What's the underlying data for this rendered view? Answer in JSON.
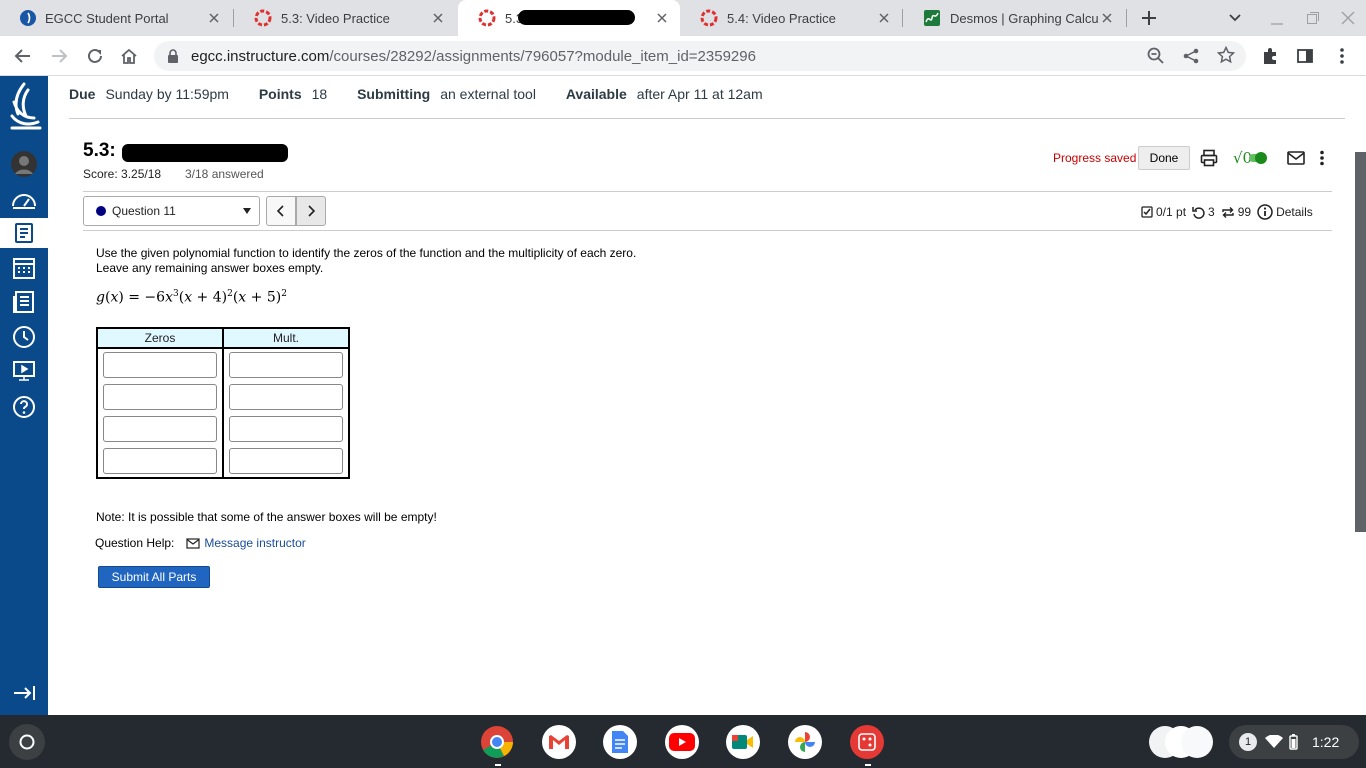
{
  "browser": {
    "tabs": [
      {
        "title": "EGCC Student Portal",
        "icon": "egcc-icon"
      },
      {
        "title": "5.3: Video Practice",
        "icon": "myopenmath-icon"
      },
      {
        "title": "5.3:",
        "icon": "myopenmath-icon",
        "active": true
      },
      {
        "title": "5.4: Video Practice",
        "icon": "myopenmath-icon"
      },
      {
        "title": "Desmos | Graphing Calcul",
        "icon": "desmos-icon"
      }
    ],
    "url_host": "egcc.instructure.com",
    "url_path": "/courses/28292/assignments/796057?module_item_id=2359296"
  },
  "assignment": {
    "due_label": "Due",
    "due_value": "Sunday by 11:59pm",
    "points_label": "Points",
    "points_value": "18",
    "submitting_label": "Submitting",
    "submitting_value": "an external tool",
    "available_label": "Available",
    "available_value": "after Apr 11 at 12am"
  },
  "homework": {
    "title": "5.3:",
    "score": "Score: 3.25/18",
    "answered": "3/18 answered",
    "progress_saved": "Progress saved",
    "done_label": "Done",
    "question_select": "Question 11",
    "points": "0/1 pt",
    "retries": "3",
    "attempts": "99",
    "details_label": "Details",
    "prompt_line1": "Use the given polynomial function to identify the zeros of the function and the multiplicity of each zero.",
    "prompt_line2": "Leave any remaining answer boxes empty.",
    "table_headers": [
      "Zeros",
      "Mult."
    ],
    "note": "Note: It is possible that some of the answer boxes will be empty!",
    "help_label": "Question Help:",
    "message_label": "Message instructor",
    "submit_label": "Submit All Parts"
  },
  "shelf": {
    "notification_count": "1",
    "time": "1:22"
  },
  "colors": {
    "canvas_sidebar": "#0a4a8a",
    "progress_saved": "#cc0000",
    "submit_button": "#2066c0",
    "table_header": "#e0f8ff"
  }
}
